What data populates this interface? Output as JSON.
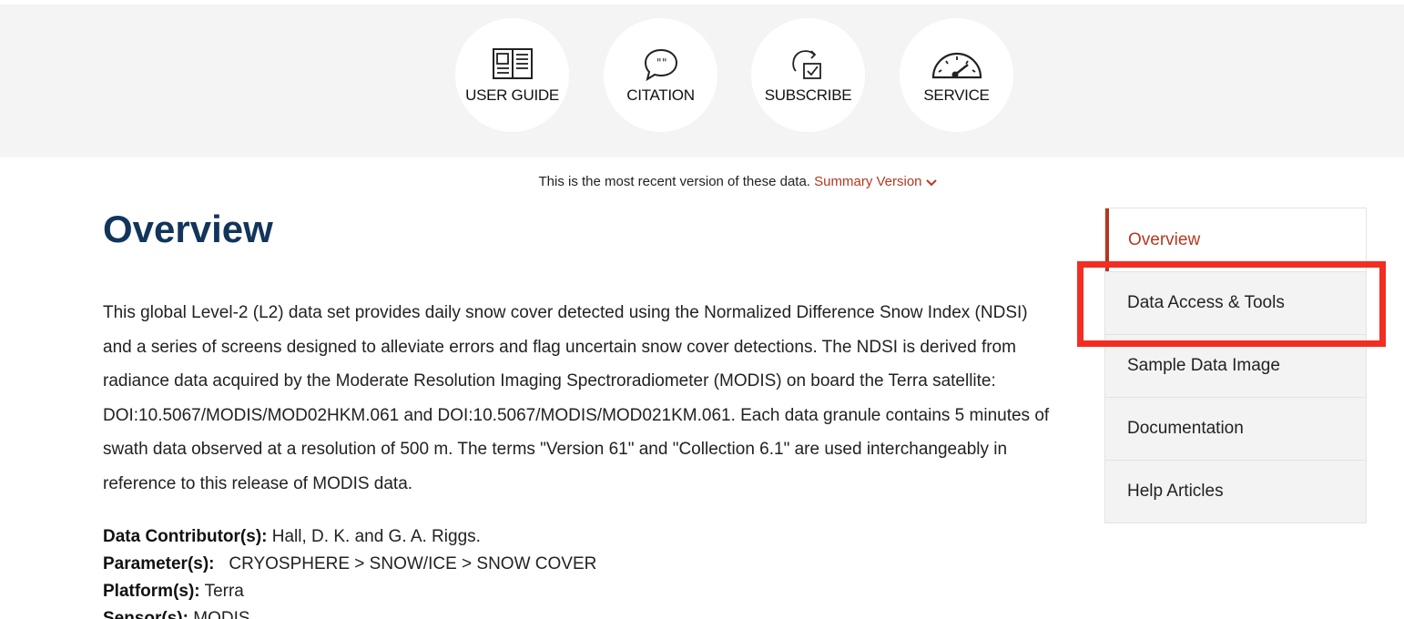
{
  "tools": [
    {
      "label": "USER GUIDE",
      "icon": "user-guide-icon"
    },
    {
      "label": "CITATION",
      "icon": "citation-icon"
    },
    {
      "label": "SUBSCRIBE",
      "icon": "subscribe-icon"
    },
    {
      "label": "SERVICE",
      "icon": "service-icon"
    }
  ],
  "version": {
    "text": "This is the most recent version of these data.",
    "link": "Summary Version"
  },
  "title": "Overview",
  "abstract": "This global Level-2 (L2) data set provides daily snow cover detected using the Normalized Difference Snow Index (NDSI) and a series of screens designed to alleviate errors and flag uncertain snow cover detections. The NDSI is derived from radiance data acquired by the Moderate Resolution Imaging Spectroradiometer (MODIS) on board the Terra satellite: DOI:10.5067/MODIS/MOD02HKM.061 and DOI:10.5067/MODIS/MOD021KM.061. Each data granule contains 5 minutes of swath data observed at a resolution of 500 m. The terms \"Version 61\" and \"Collection 6.1\" are used interchangeably in reference to this release of MODIS data.",
  "meta": {
    "contributors_label": "Data Contributor(s):",
    "contributors_value": "Hall, D. K. and G. A. Riggs.",
    "parameters_label": "Parameter(s):",
    "parameters_value": "CRYOSPHERE >  SNOW/ICE >  SNOW COVER",
    "platforms_label": "Platform(s):",
    "platforms_value": "Terra",
    "sensors_label": "Sensor(s):",
    "sensors_value": "MODIS"
  },
  "side_nav": [
    {
      "label": "Overview",
      "active": true
    },
    {
      "label": "Data Access & Tools",
      "active": false
    },
    {
      "label": "Sample Data Image",
      "active": false
    },
    {
      "label": "Documentation",
      "active": false
    },
    {
      "label": "Help Articles",
      "active": false
    }
  ],
  "colors": {
    "accent": "#b4381f",
    "title": "#12355b",
    "highlight": "#f32d22",
    "band": "#f4f4f4"
  }
}
